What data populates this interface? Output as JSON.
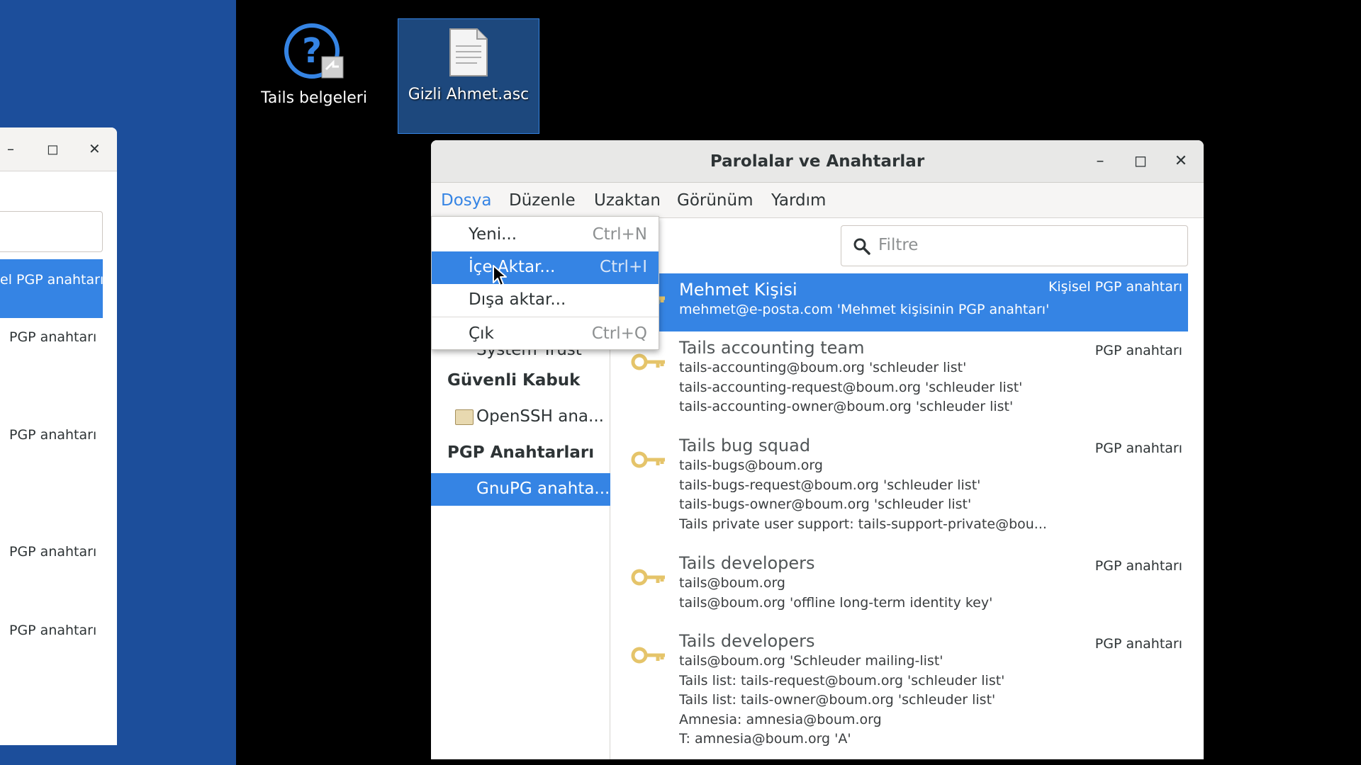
{
  "desktop": {
    "icons": [
      {
        "label": "Tails belgeleri",
        "icon": "help-icon"
      },
      {
        "label": "Gizli Ahmet.asc",
        "icon": "document-icon"
      }
    ]
  },
  "background_window": {
    "selected_row_text": "el PGP anahtarı",
    "rows": [
      "PGP anahtarı",
      "PGP anahtarı",
      "PGP anahtarı",
      "PGP anahtarı"
    ]
  },
  "window": {
    "title": "Parolalar ve Anahtarlar",
    "menubar": [
      "Dosya",
      "Düzenle",
      "Uzaktan",
      "Görünüm",
      "Yardım"
    ],
    "filter_placeholder": "Filtre",
    "sidebar": {
      "partial_item": "System Trust",
      "section_ssh": "Güvenli Kabuk",
      "ssh_item": "OpenSSH ana...",
      "section_pgp": "PGP Anahtarları",
      "pgp_item": "GnuPG anahta..."
    },
    "keys": [
      {
        "name": "Mehmet Kişisi",
        "type": "Kişisel PGP anahtarı",
        "lines": [
          "mehmet@e-posta.com 'Mehmet kişisinin PGP anahtarı'"
        ]
      },
      {
        "name": "Tails accounting team",
        "type": "PGP anahtarı",
        "lines": [
          "tails-accounting@boum.org 'schleuder list'",
          "tails-accounting-request@boum.org 'schleuder list'",
          "tails-accounting-owner@boum.org 'schleuder list'"
        ]
      },
      {
        "name": "Tails bug squad",
        "type": "PGP anahtarı",
        "lines": [
          "tails-bugs@boum.org",
          "tails-bugs-request@boum.org 'schleuder list'",
          "tails-bugs-owner@boum.org 'schleuder list'",
          "Tails private user support: tails-support-private@bou..."
        ]
      },
      {
        "name": "Tails developers",
        "type": "PGP anahtarı",
        "lines": [
          "tails@boum.org",
          "tails@boum.org 'offline long-term identity key'"
        ]
      },
      {
        "name": "Tails developers",
        "type": "PGP anahtarı",
        "lines": [
          "tails@boum.org 'Schleuder mailing-list'",
          "Tails list: tails-request@boum.org 'schleuder list'",
          "Tails list: tails-owner@boum.org 'schleuder list'",
          "Amnesia: amnesia@boum.org",
          "T: amnesia@boum.org 'A'"
        ]
      }
    ]
  },
  "file_menu": {
    "items": [
      {
        "label": "Yeni...",
        "shortcut": "Ctrl+N"
      },
      {
        "label": "İçe Aktar...",
        "shortcut": "Ctrl+I"
      },
      {
        "label": "Dışa aktar...",
        "shortcut": ""
      },
      {
        "label": "Çık",
        "shortcut": "Ctrl+Q"
      }
    ]
  },
  "colors": {
    "accent": "#3584e4",
    "desktop_blue": "#1c4e9b",
    "desktop_bg": "#000000",
    "key_icon": "#e5c46a"
  }
}
